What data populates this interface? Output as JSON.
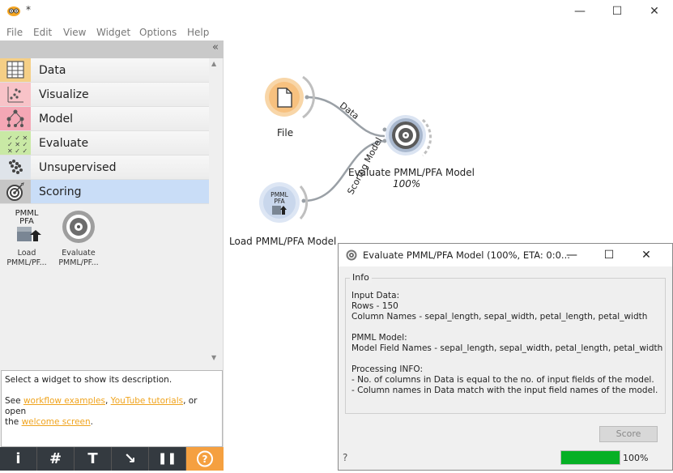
{
  "window": {
    "title": "*"
  },
  "menu": [
    "File",
    "Edit",
    "View",
    "Widget",
    "Options",
    "Help"
  ],
  "window_buttons": [
    "—",
    "☐",
    "✕"
  ],
  "dock": {
    "collapse_glyph": "«",
    "categories": [
      {
        "label": "Data",
        "icon": "table-icon",
        "color": "#f5cf86"
      },
      {
        "label": "Visualize",
        "icon": "scatter-icon",
        "color": "#f8c3c8"
      },
      {
        "label": "Model",
        "icon": "tree-icon",
        "color": "#f4a7b5"
      },
      {
        "label": "Evaluate",
        "icon": "checklist-icon",
        "color": "#c9e9a5"
      },
      {
        "label": "Unsupervised",
        "icon": "cluster-icon",
        "color": "#dfe4ea"
      },
      {
        "label": "Scoring",
        "icon": "target-icon",
        "color": "#c6c6c6"
      }
    ],
    "tools": [
      {
        "label1": "Load",
        "label2": "PMML/PF...",
        "icon": "pmml-icon",
        "icon_text1": "PMML",
        "icon_text2": "PFA"
      },
      {
        "label1": "Evaluate",
        "label2": "PMML/PF...",
        "icon": "evaluate-icon"
      }
    ],
    "description": {
      "line1": "Select a widget to show its description.",
      "see": "See ",
      "link1": "workflow examples",
      "comma": ", ",
      "link2": "YouTube tutorials",
      "or_open": ", or open",
      "the": "the ",
      "link3": "welcome screen",
      "period": "."
    },
    "bottom_buttons": [
      "i",
      "#",
      "T",
      "↘",
      "❚❚",
      "?"
    ]
  },
  "canvas": {
    "nodes": [
      {
        "label": "File",
        "icon": "file-icon"
      },
      {
        "label": "Evaluate PMML/PFA Model",
        "status": "100%",
        "icon": "evaluate-icon"
      },
      {
        "label": "Load PMML/PFA Model",
        "icon": "pmml-icon",
        "icon_text1": "PMML",
        "icon_text2": "PFA"
      }
    ],
    "links": [
      "Data",
      "Scoring Model"
    ]
  },
  "dialog": {
    "title": "Evaluate PMML/PFA Model (100%, ETA: 0:0...",
    "buttons": [
      "—",
      "☐",
      "✕"
    ],
    "group_title": "Info",
    "info": [
      "Input Data:",
      "Rows - 150",
      "Column Names - sepal_length, sepal_width, petal_length, petal_width",
      "",
      "PMML Model:",
      "Model Field Names - sepal_length, sepal_width, petal_length, petal_width",
      "",
      "Processing INFO:",
      "- No. of columns in Data is equal to the no. of input fields of the model.",
      "- Column names in Data match with the input field names of the model."
    ],
    "score_label": "Score",
    "help_glyph": "?",
    "progress": 1.0,
    "progress_label": "100%"
  },
  "colors": {
    "accent": "#f5a040",
    "selection": "#c9ddf7",
    "progress": "#06b025",
    "link": "#f0a41e"
  }
}
